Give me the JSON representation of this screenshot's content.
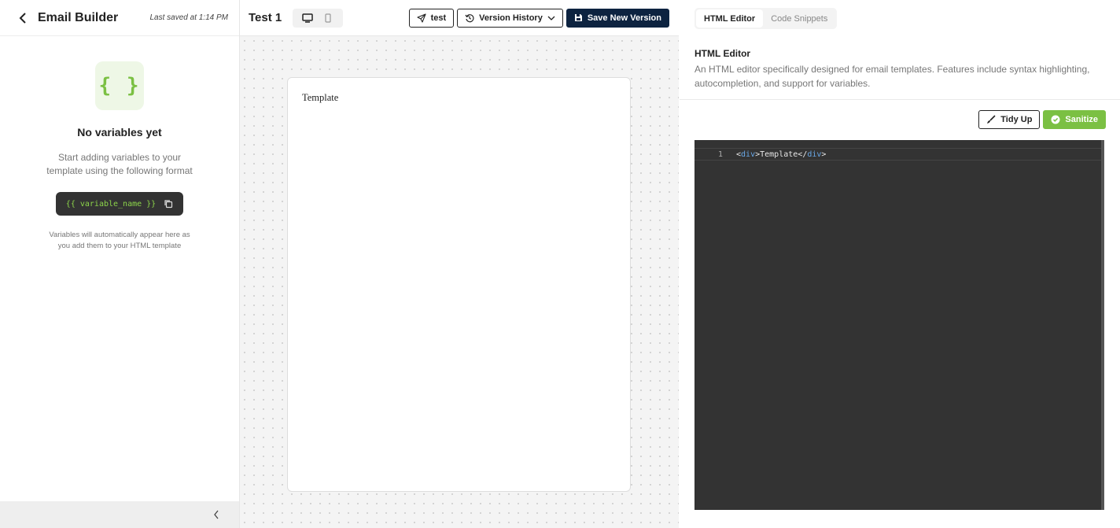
{
  "left_panel": {
    "title": "Email Builder",
    "last_saved": "Last saved at 1:14 PM",
    "empty_state": {
      "icon_glyph": "{ }",
      "heading": "No variables yet",
      "description": "Start adding variables to your template using the following format",
      "format_example": "{{ variable_name }}",
      "hint": "Variables will automatically appear here as you add them to your HTML template"
    }
  },
  "toolbar": {
    "template_name": "Test 1",
    "test_label": "test",
    "version_history_label": "Version History",
    "save_label": "Save New Version"
  },
  "canvas": {
    "content_text": "Template"
  },
  "right_panel": {
    "tabs": [
      {
        "label": "HTML Editor",
        "active": true
      },
      {
        "label": "Code Snippets",
        "active": false
      }
    ],
    "editor_title": "HTML Editor",
    "editor_description": "An HTML editor specifically designed for email templates. Features include syntax highlighting, autocompletion, and support for variables.",
    "tidy_label": "Tidy Up",
    "sanitize_label": "Sanitize",
    "code": {
      "line_number": "1",
      "open_tag": "div",
      "text": "Template",
      "close_tag": "div"
    }
  },
  "colors": {
    "accent_green": "#7bc043",
    "primary_navy": "#0d2340",
    "editor_bg": "#333333"
  }
}
